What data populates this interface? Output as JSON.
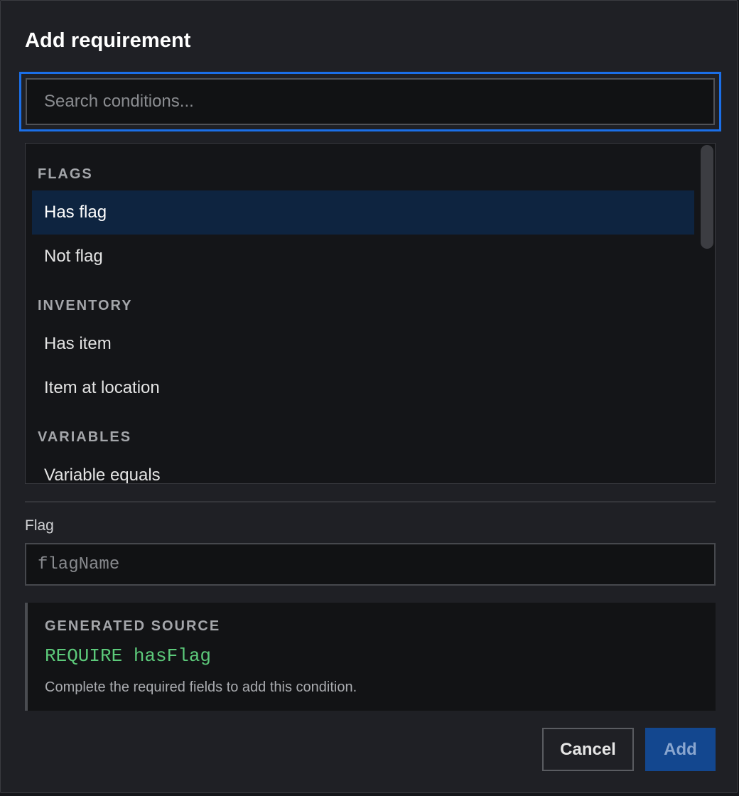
{
  "dialog": {
    "title": "Add requirement"
  },
  "search": {
    "placeholder": "Search conditions..."
  },
  "list": {
    "groups": [
      {
        "header": "FLAGS",
        "items": [
          {
            "label": "Has flag",
            "selected": true
          },
          {
            "label": "Not flag",
            "selected": false
          }
        ]
      },
      {
        "header": "INVENTORY",
        "items": [
          {
            "label": "Has item",
            "selected": false
          },
          {
            "label": "Item at location",
            "selected": false
          }
        ]
      },
      {
        "header": "VARIABLES",
        "items": [
          {
            "label": "Variable equals",
            "selected": false
          }
        ]
      }
    ]
  },
  "form": {
    "flag_label": "Flag",
    "flag_placeholder": "flagName",
    "flag_value": ""
  },
  "source": {
    "label": "GENERATED SOURCE",
    "code": "REQUIRE hasFlag",
    "hint": "Complete the required fields to add this condition."
  },
  "actions": {
    "cancel_label": "Cancel",
    "add_label": "Add"
  },
  "colors": {
    "accent": "#1b6fe8",
    "selected_row": "#0e2440",
    "code_green": "#5cc97a",
    "add_button": "#13478f"
  }
}
